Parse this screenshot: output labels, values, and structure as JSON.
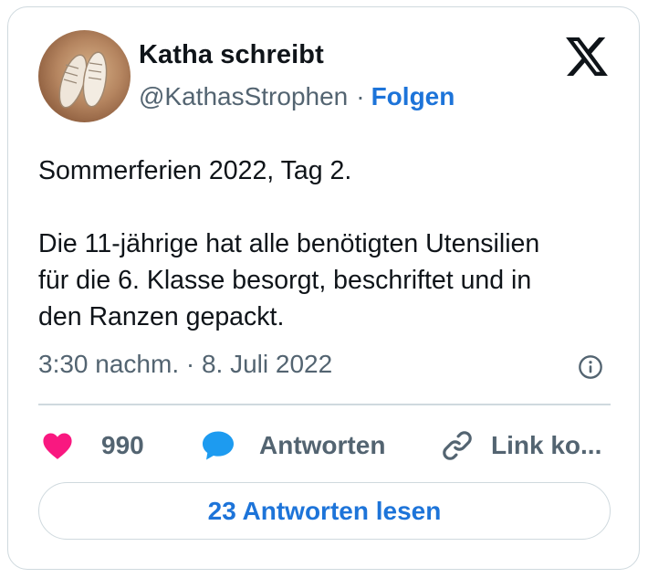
{
  "author": {
    "name": "Katha schreibt",
    "handle": "@KathasStrophen",
    "separator": "·",
    "follow_label": "Folgen"
  },
  "tweet": {
    "paragraphs": [
      [
        "Sommerferien 2022, Tag 2."
      ],
      [
        "Die 11-jährige hat alle benötigten Utensilien",
        "für die 6. Klasse besorgt, beschriftet und in",
        "den Ranzen gepackt."
      ]
    ],
    "timestamp": "3:30 nachm. · 8. Juli 2022"
  },
  "actions": {
    "like_count": "990",
    "reply_label": "Antworten",
    "copy_link_label": "Link ko..."
  },
  "read_replies_label": "23 Antworten lesen",
  "icons": {
    "logo": "x-logo-icon",
    "info": "info-icon",
    "like": "heart-icon",
    "reply": "speech-bubble-icon",
    "copy": "link-icon"
  },
  "colors": {
    "accent": "#1d74d9",
    "like": "#f91880",
    "reply": "#1d9bf0",
    "muted": "#536471",
    "border": "#cfd9de"
  }
}
